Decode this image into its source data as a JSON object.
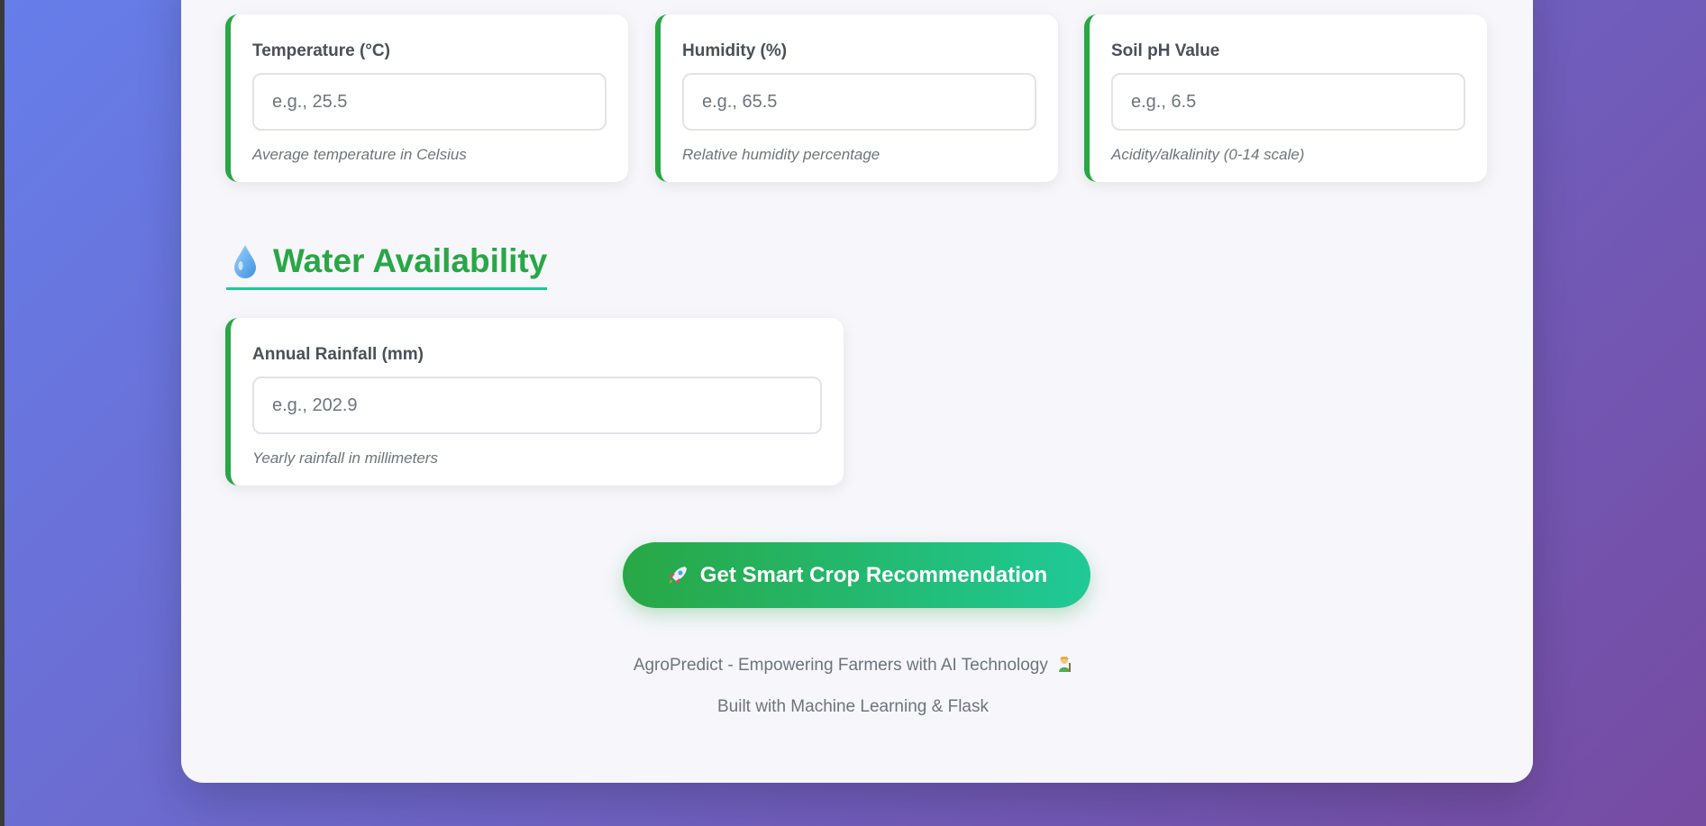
{
  "cards": {
    "temperature": {
      "label": "Temperature (°C)",
      "placeholder": "e.g., 25.5",
      "value": "",
      "hint": "Average temperature in Celsius"
    },
    "humidity": {
      "label": "Humidity (%)",
      "placeholder": "e.g., 65.5",
      "value": "",
      "hint": "Relative humidity percentage"
    },
    "ph": {
      "label": "Soil pH Value",
      "placeholder": "e.g., 6.5",
      "value": "",
      "hint": "Acidity/alkalinity (0-14 scale)"
    },
    "rainfall": {
      "label": "Annual Rainfall (mm)",
      "placeholder": "e.g., 202.9",
      "value": "",
      "hint": "Yearly rainfall in millimeters"
    }
  },
  "section": {
    "title": "Water Availability",
    "icon": "water-drop-icon"
  },
  "submit": {
    "label": "Get Smart Crop Recommendation",
    "icon": "rocket-icon"
  },
  "footer": {
    "line1": "AgroPredict - Empowering Farmers with AI Technology",
    "line1_icon": "farmer-icon",
    "line2": "Built with Machine Learning & Flask"
  },
  "colors": {
    "accent_green": "#28a745",
    "accent_teal": "#20c997",
    "background_start": "#667eea",
    "background_end": "#764ba2"
  }
}
